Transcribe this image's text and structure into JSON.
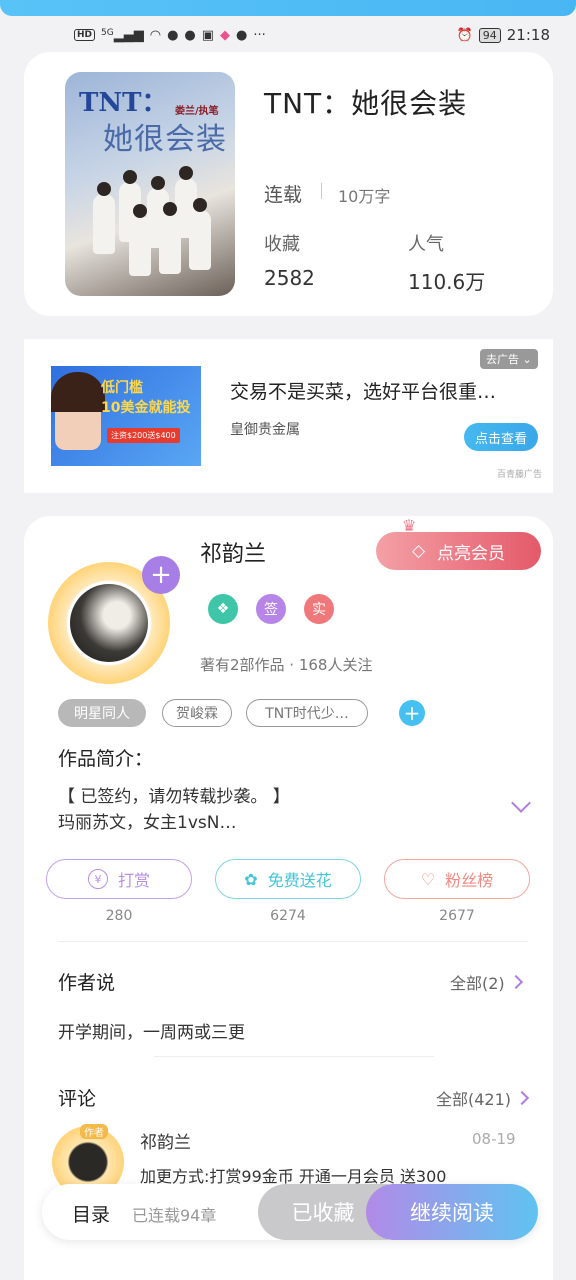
{
  "status_bar": {
    "left_icons": [
      "hd-icon",
      "signal-icon",
      "wifi-icon",
      "qq-icon",
      "qq-icon",
      "app-icon",
      "app-icon",
      "wechat-icon",
      "more-icon"
    ],
    "hd": "HD",
    "network": "5G",
    "more": "···",
    "battery": "94",
    "time": "21:18"
  },
  "book": {
    "title": "TNT：她很会装",
    "status": "连载",
    "words": "10万字",
    "collect_label": "收藏",
    "collect_value": "2582",
    "popularity_label": "人气",
    "popularity_value": "110.6万",
    "cover": {
      "title": "TNT：",
      "author": "娄兰/执笔",
      "subtitle": "她很会装"
    }
  },
  "ad": {
    "close_label": "去广告",
    "headline": "交易不是买菜，选好平台很重…",
    "source": "皇御贵金属",
    "button": "点击查看",
    "mark": "百青藤广告",
    "image_text_1": "低门槛",
    "image_text_2": "10美金就能投",
    "image_text_3": "注资$200送$400"
  },
  "author": {
    "name": "祁韵兰",
    "vip_button": "点亮会员",
    "badges": [
      "签",
      "实"
    ],
    "meta": "著有2部作品 · 168人关注",
    "tags": [
      "明星同人",
      "贺峻霖",
      "TNT时代少…"
    ]
  },
  "intro": {
    "title": "作品简介：",
    "line1": "【 已签约，请勿转载抄袭。 】",
    "line2": "玛丽苏文，女主1vsN…"
  },
  "actions": [
    {
      "label": "打赏",
      "count": "280",
      "color": "#b88ee6"
    },
    {
      "label": "免费送花",
      "count": "6274",
      "color": "#45c5d8"
    },
    {
      "label": "粉丝榜",
      "count": "2677",
      "color": "#f08a82"
    }
  ],
  "author_says": {
    "title": "作者说",
    "all": "全部(2)",
    "text": "开学期间，一周两或三更"
  },
  "comments": {
    "title": "评论",
    "all": "全部(421)",
    "author_tag": "作者",
    "first": {
      "name": "祁韵兰",
      "date": "08-19",
      "text": "加更方式:打赏99金币  开通一月会员  送300"
    }
  },
  "bottom": {
    "toc": "目录",
    "toc_count": "已连载94章",
    "favorited": "已收藏",
    "continue": "继续阅读"
  }
}
